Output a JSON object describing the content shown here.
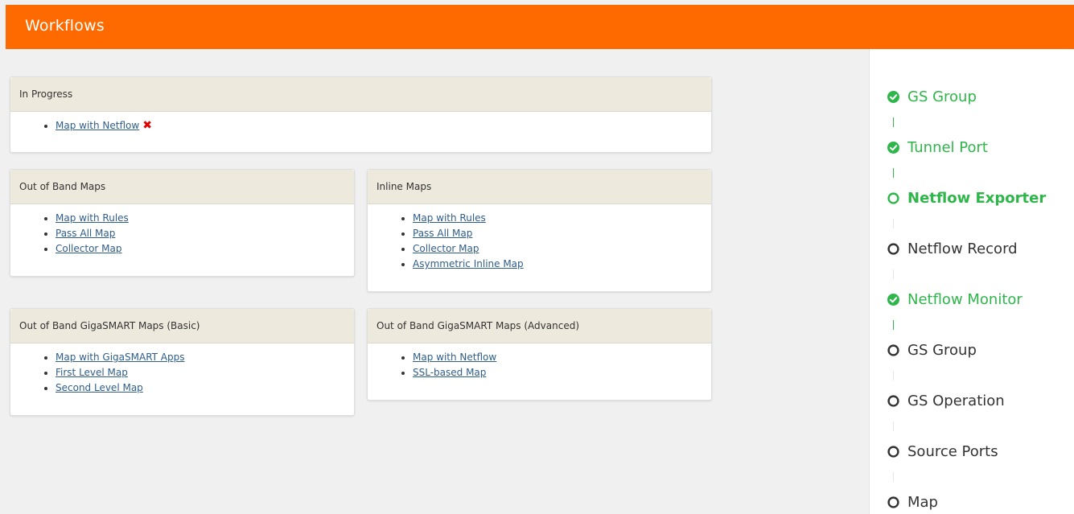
{
  "header": {
    "title": "Workflows"
  },
  "in_progress": {
    "title": "In Progress",
    "items": [
      {
        "label": "Map with Netflow",
        "remove_icon": "close-icon"
      }
    ]
  },
  "out_of_band_maps": {
    "title": "Out of Band Maps",
    "items": [
      "Map with Rules",
      "Pass All Map",
      "Collector Map"
    ]
  },
  "inline_maps": {
    "title": "Inline Maps",
    "items": [
      "Map with Rules",
      "Pass All Map",
      "Collector Map",
      "Asymmetric Inline Map"
    ]
  },
  "gigasmart_basic": {
    "title": "Out of Band GigaSMART Maps (Basic)",
    "items": [
      "Map with GigaSMART Apps",
      "First Level Map",
      "Second Level Map"
    ]
  },
  "gigasmart_advanced": {
    "title": "Out of Band GigaSMART Maps (Advanced)",
    "items": [
      "Map with Netflow",
      "SSL-based Map"
    ]
  },
  "steps": [
    {
      "label": "GS Group",
      "state": "done"
    },
    {
      "label": "Tunnel Port",
      "state": "done"
    },
    {
      "label": "Netflow Exporter",
      "state": "current"
    },
    {
      "label": "Netflow Record",
      "state": "pending"
    },
    {
      "label": "Netflow Monitor",
      "state": "done"
    },
    {
      "label": "GS Group",
      "state": "pending"
    },
    {
      "label": "GS Operation",
      "state": "pending"
    },
    {
      "label": "Source Ports",
      "state": "pending"
    },
    {
      "label": "Map",
      "state": "pending"
    }
  ],
  "colors": {
    "header": "#ff6a00",
    "step_active": "#2fb64a",
    "link": "#2f5d8a",
    "remove": "#e00000",
    "panel_head": "#ede9dc"
  }
}
